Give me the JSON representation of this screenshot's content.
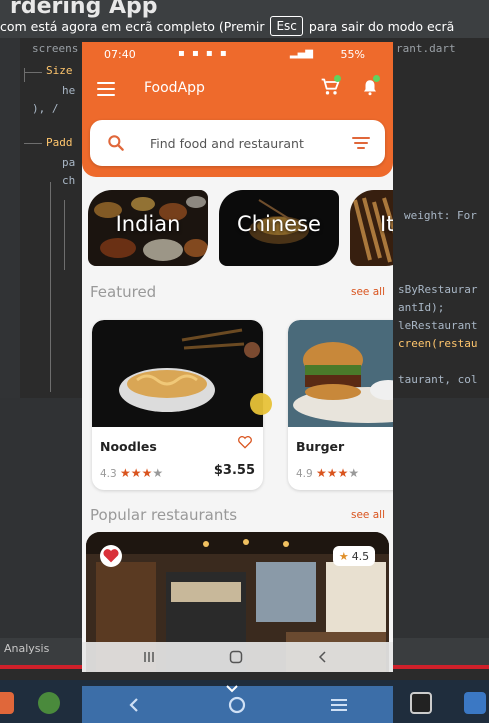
{
  "ide": {
    "title": "rdering App",
    "tab_left": "screens",
    "tab_right": "rant.dart",
    "status_left": "Analysis",
    "code_left": [
      "Size",
      "he",
      "), /",
      "Padd",
      "pa",
      "ch"
    ],
    "code_right": [
      "weight: For",
      "sByRestaurar",
      "antId);",
      "leRestaurant",
      "creen(restau",
      "taurant, col"
    ]
  },
  "fullscreen_notice": {
    "text_before": "com está agora em ecrã completo (Premir",
    "key": "Esc",
    "text_after": "para sair do modo ecrã"
  },
  "status_bar": {
    "time": "07:40",
    "battery": "55%"
  },
  "app": {
    "title": "FoodApp",
    "search": {
      "placeholder": "Find food and restaurant"
    },
    "categories": [
      {
        "label": "Indian"
      },
      {
        "label": "Chinese"
      },
      {
        "label": "It"
      }
    ],
    "featured": {
      "title": "Featured",
      "see_all": "see all",
      "items": [
        {
          "name": "Noodles",
          "rating": "4.3",
          "stars_filled": 3,
          "price": "$3.55"
        },
        {
          "name": "Burger",
          "rating": "4.9",
          "stars_filled": 3,
          "price": ""
        }
      ]
    },
    "popular": {
      "title": "Popular restaurants",
      "see_all": "see all",
      "items": [
        {
          "rating": "4.5"
        }
      ]
    }
  },
  "colors": {
    "accent": "#ee6a2c",
    "link": "#d9541e",
    "ide_background": "#2b2b2b",
    "taskbar": "#1f2d3d"
  },
  "icons": [
    "menu-icon",
    "cart-icon",
    "bell-icon",
    "search-icon",
    "filter-icon",
    "heart-icon",
    "star-icon",
    "home-icon",
    "back-icon",
    "recents-icon",
    "chevron-down-icon"
  ]
}
